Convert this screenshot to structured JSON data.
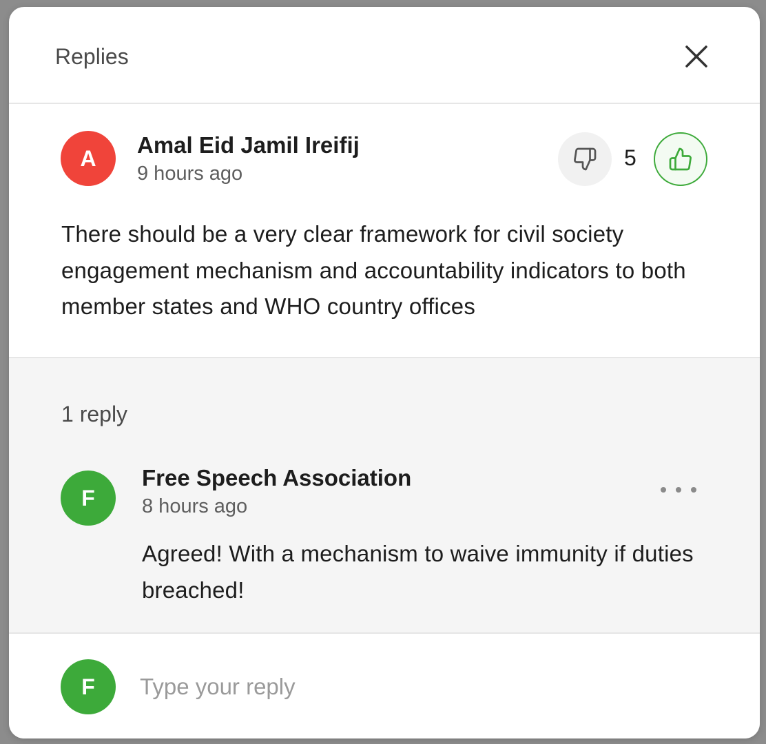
{
  "modal": {
    "title": "Replies"
  },
  "comment": {
    "avatar_letter": "A",
    "avatar_color": "#f0443a",
    "author": "Amal Eid Jamil Ireifij",
    "time": "9 hours ago",
    "like_count": "5",
    "body": "There should be a very clear framework for civil society engagement mechanism and accountability indicators to both member states and WHO country offices",
    "dislike_icon": "thumbs-down-icon",
    "like_icon": "thumbs-up-icon",
    "like_color": "#3daa3a"
  },
  "replies": {
    "count_label": "1 reply",
    "items": [
      {
        "avatar_letter": "F",
        "avatar_color": "#3daa3a",
        "author": "Free Speech Association",
        "time": "8 hours ago",
        "body": "Agreed! With a mechanism to waive immunity if duties breached!"
      }
    ]
  },
  "composer": {
    "avatar_letter": "F",
    "avatar_color": "#3daa3a",
    "placeholder": "Type your reply"
  }
}
